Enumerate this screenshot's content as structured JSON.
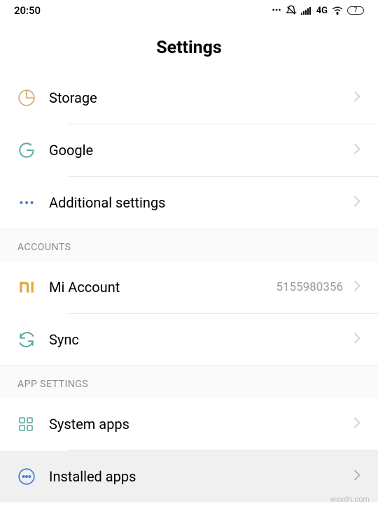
{
  "status": {
    "time": "20:50",
    "network": "4G",
    "battery": "7"
  },
  "title": "Settings",
  "items": [
    {
      "label": "Storage"
    },
    {
      "label": "Google"
    },
    {
      "label": "Additional settings"
    }
  ],
  "sections": {
    "accounts": {
      "header": "ACCOUNTS",
      "items": [
        {
          "label": "Mi Account",
          "value": "5155980356"
        },
        {
          "label": "Sync"
        }
      ]
    },
    "appsettings": {
      "header": "APP SETTINGS",
      "items": [
        {
          "label": "System apps"
        },
        {
          "label": "Installed apps"
        }
      ]
    }
  },
  "watermark": "wsxdn.com"
}
